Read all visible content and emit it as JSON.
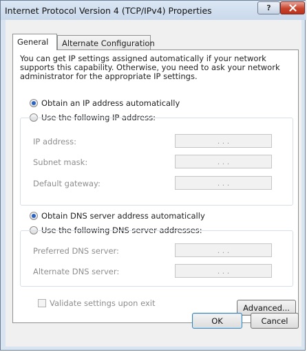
{
  "window": {
    "title": "Internet Protocol Version 4 (TCP/IPv4) Properties",
    "help_label": "?",
    "close_icon": "close-icon"
  },
  "tabs": [
    {
      "label": "General",
      "selected": true
    },
    {
      "label": "Alternate Configuration",
      "selected": false
    }
  ],
  "general": {
    "description": "You can get IP settings assigned automatically if your network supports this capability. Otherwise, you need to ask your network administrator for the appropriate IP settings.",
    "ip_auto_label": "Obtain an IP address automatically",
    "ip_manual_label": "Use the following IP address:",
    "ip_fields": [
      {
        "label": "IP address:",
        "value": ". . ."
      },
      {
        "label": "Subnet mask:",
        "value": ". . ."
      },
      {
        "label": "Default gateway:",
        "value": ". . ."
      }
    ],
    "dns_auto_label": "Obtain DNS server address automatically",
    "dns_manual_label": "Use the following DNS server addresses:",
    "dns_fields": [
      {
        "label": "Preferred DNS server:",
        "value": ". . ."
      },
      {
        "label": "Alternate DNS server:",
        "value": ". . ."
      }
    ],
    "validate_label": "Validate settings upon exit",
    "advanced_label": "Advanced..."
  },
  "buttons": {
    "ok_label": "OK",
    "cancel_label": "Cancel"
  },
  "colors": {
    "title_bar": "#c9d8eb",
    "close_button": "#c9442c",
    "radio_selected": "#2a63c1"
  }
}
